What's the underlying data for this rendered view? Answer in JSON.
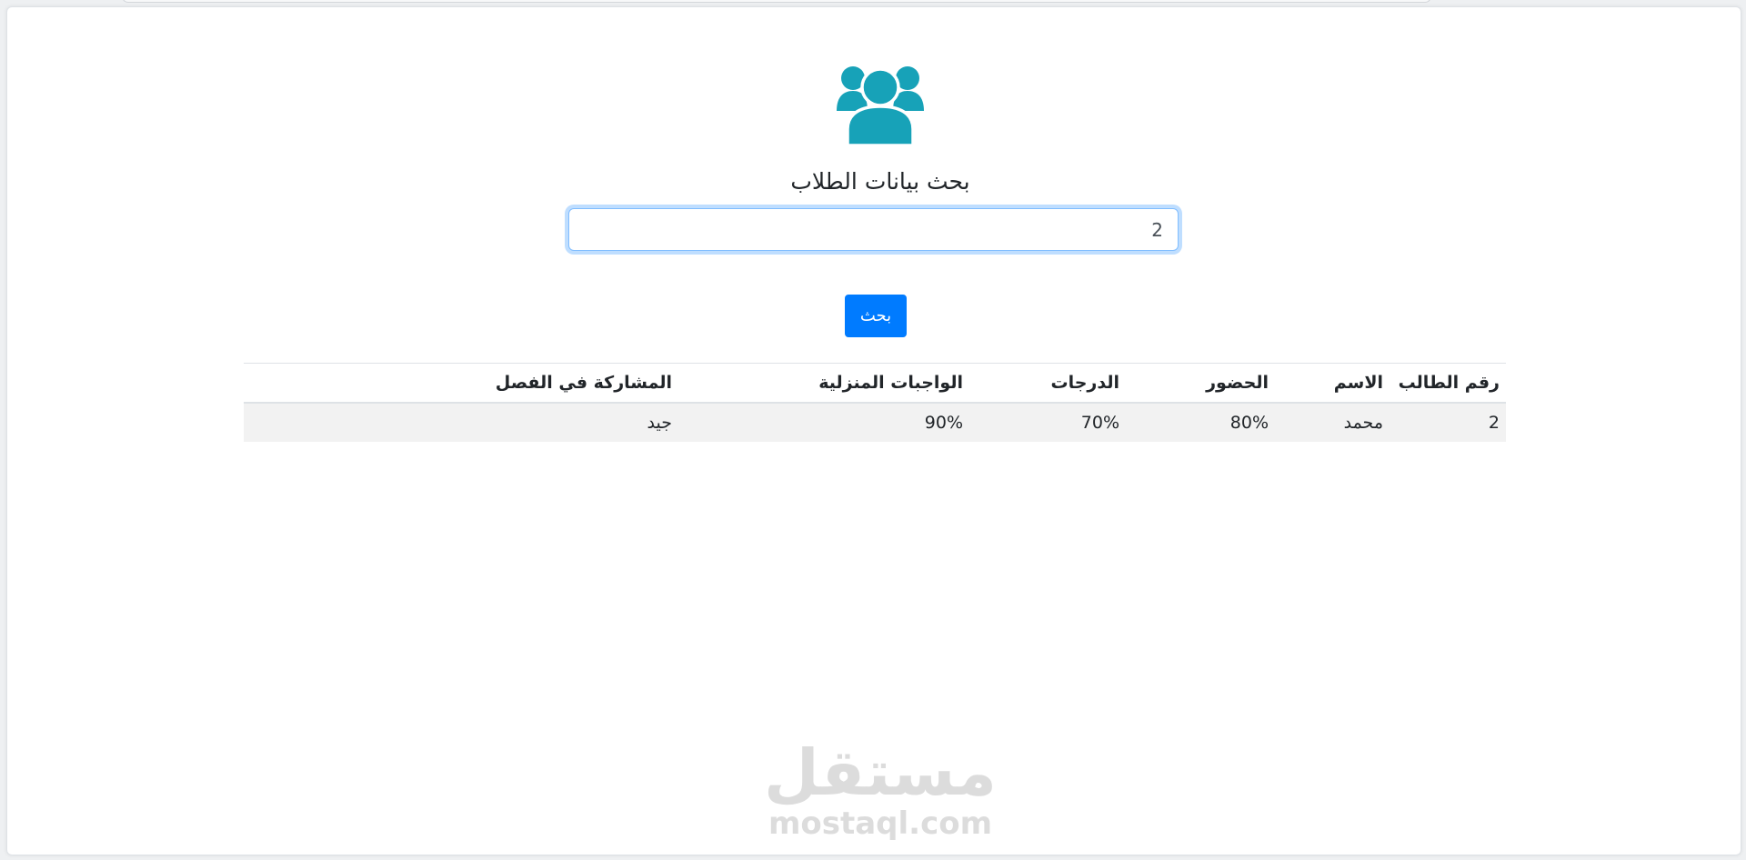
{
  "page": {
    "title": "بحث بيانات الطلاب",
    "icon": "users-icon",
    "accent_color": "#17a2b8",
    "button_color": "#007bff"
  },
  "search": {
    "value": "2",
    "button_label": "بحث"
  },
  "table": {
    "headers": {
      "student_id": "رقم الطالب",
      "name": "الاسم",
      "attendance": "الحضور",
      "grades": "الدرجات",
      "homework": "الواجبات المنزلية",
      "participation": "المشاركة في الفصل"
    },
    "rows": [
      {
        "student_id": "2",
        "name": "محمد",
        "attendance": "80%",
        "grades": "70%",
        "homework": "90%",
        "participation": "جيد"
      }
    ]
  },
  "watermark": {
    "arabic": "مستقل",
    "latin": "mostaql.com"
  }
}
